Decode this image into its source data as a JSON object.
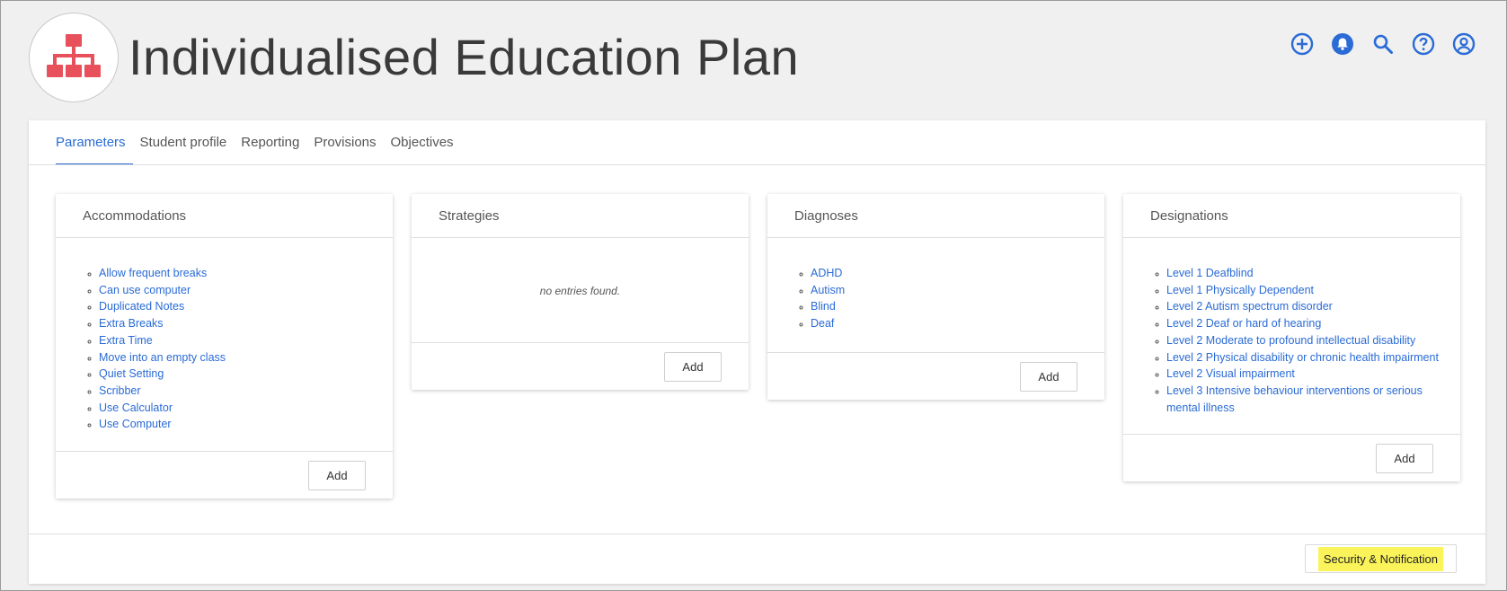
{
  "header": {
    "title": "Individualised Education Plan",
    "logo_icon": "sitemap-icon",
    "accent": "#2a6bd6",
    "logo_color": "#e8505b",
    "icons": [
      "add-circle-icon",
      "bell-icon",
      "search-icon",
      "help-icon",
      "user-icon"
    ]
  },
  "tabs": [
    {
      "label": "Parameters",
      "active": true
    },
    {
      "label": "Student profile",
      "active": false
    },
    {
      "label": "Reporting",
      "active": false
    },
    {
      "label": "Provisions",
      "active": false
    },
    {
      "label": "Objectives",
      "active": false
    }
  ],
  "panels": {
    "accommodations": {
      "title": "Accommodations",
      "items": [
        "Allow frequent breaks",
        "Can use computer",
        "Duplicated Notes",
        "Extra Breaks",
        "Extra Time",
        "Move into an empty class",
        "Quiet Setting",
        "Scribber",
        "Use Calculator",
        "Use Computer"
      ],
      "add_label": "Add"
    },
    "strategies": {
      "title": "Strategies",
      "empty_text": "no entries found.",
      "add_label": "Add"
    },
    "diagnoses": {
      "title": "Diagnoses",
      "items": [
        "ADHD",
        "Autism",
        "Blind",
        "Deaf"
      ],
      "add_label": "Add"
    },
    "designations": {
      "title": "Designations",
      "items": [
        "Level 1 Deafblind",
        "Level 1 Physically Dependent",
        "Level 2 Autism spectrum disorder",
        "Level 2 Deaf or hard of hearing",
        "Level 2 Moderate to profound intellectual disability",
        "Level 2 Physical disability or chronic health impairment",
        "Level 2 Visual impairment",
        "Level 3 Intensive behaviour interventions or serious mental illness"
      ],
      "add_label": "Add"
    }
  },
  "footer": {
    "security_label": "Security & Notification",
    "highlight_color": "#fbf35a"
  }
}
